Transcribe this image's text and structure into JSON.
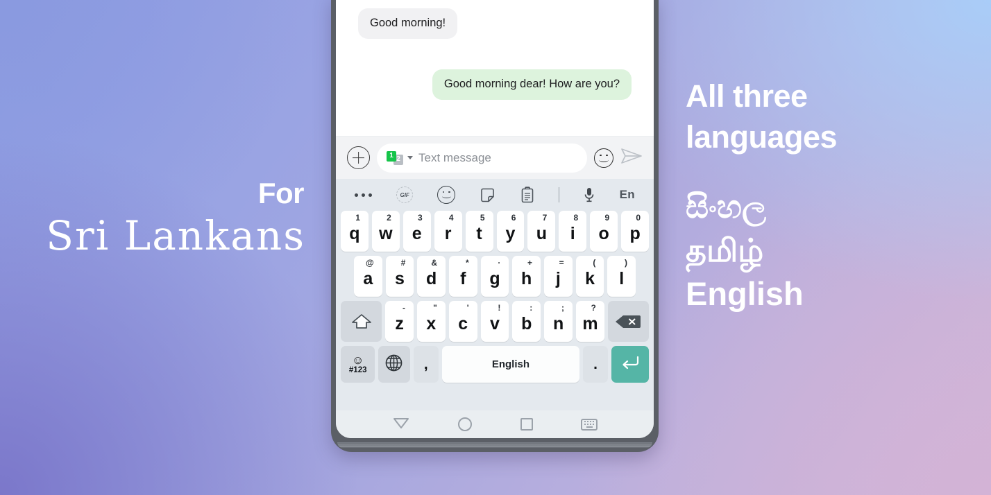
{
  "promo": {
    "left": {
      "for": "For",
      "audience": "Sri Lankans"
    },
    "right": {
      "headline_line1": "All three",
      "headline_line2": "languages",
      "languages": [
        "සිංහල",
        "தமிழ்",
        "English"
      ]
    }
  },
  "phone": {
    "chat": {
      "messages": [
        {
          "text": "Good morning!",
          "direction": "incoming"
        },
        {
          "text": "Good morning dear! How are you?",
          "direction": "outgoing"
        }
      ]
    },
    "composer": {
      "add_label": "+",
      "sim_one": "1",
      "sim_two": "2",
      "placeholder": "Text message",
      "value": ""
    },
    "keyboard": {
      "toolbar": {
        "more_label": "•••",
        "gif_label": "GIF",
        "language_indicator": "En"
      },
      "rows": {
        "row1": [
          {
            "key": "q",
            "alt": "1"
          },
          {
            "key": "w",
            "alt": "2"
          },
          {
            "key": "e",
            "alt": "3"
          },
          {
            "key": "r",
            "alt": "4"
          },
          {
            "key": "t",
            "alt": "5"
          },
          {
            "key": "y",
            "alt": "6"
          },
          {
            "key": "u",
            "alt": "7"
          },
          {
            "key": "i",
            "alt": "8"
          },
          {
            "key": "o",
            "alt": "9"
          },
          {
            "key": "p",
            "alt": "0"
          }
        ],
        "row2": [
          {
            "key": "a",
            "alt": "@"
          },
          {
            "key": "s",
            "alt": "#"
          },
          {
            "key": "d",
            "alt": "&"
          },
          {
            "key": "f",
            "alt": "*"
          },
          {
            "key": "g",
            "alt": "·"
          },
          {
            "key": "h",
            "alt": "+"
          },
          {
            "key": "j",
            "alt": "="
          },
          {
            "key": "k",
            "alt": "("
          },
          {
            "key": "l",
            "alt": ")"
          }
        ],
        "row3": [
          {
            "key": "z",
            "alt": "-"
          },
          {
            "key": "x",
            "alt": "\""
          },
          {
            "key": "c",
            "alt": "'"
          },
          {
            "key": "v",
            "alt": "!"
          },
          {
            "key": "b",
            "alt": ":"
          },
          {
            "key": "n",
            "alt": ";"
          },
          {
            "key": "m",
            "alt": "?"
          }
        ],
        "row4": {
          "symbols_glyph": "☺",
          "symbols_label": "#123",
          "comma": ",",
          "space_label": "English",
          "period": "."
        }
      }
    }
  },
  "colors": {
    "enter_key": "#55b5a6",
    "outgoing_bubble": "#ddf3dd",
    "incoming_bubble": "#f1f1f3",
    "sim_active": "#16c44a",
    "keyboard_bg": "#e4e9ee"
  }
}
